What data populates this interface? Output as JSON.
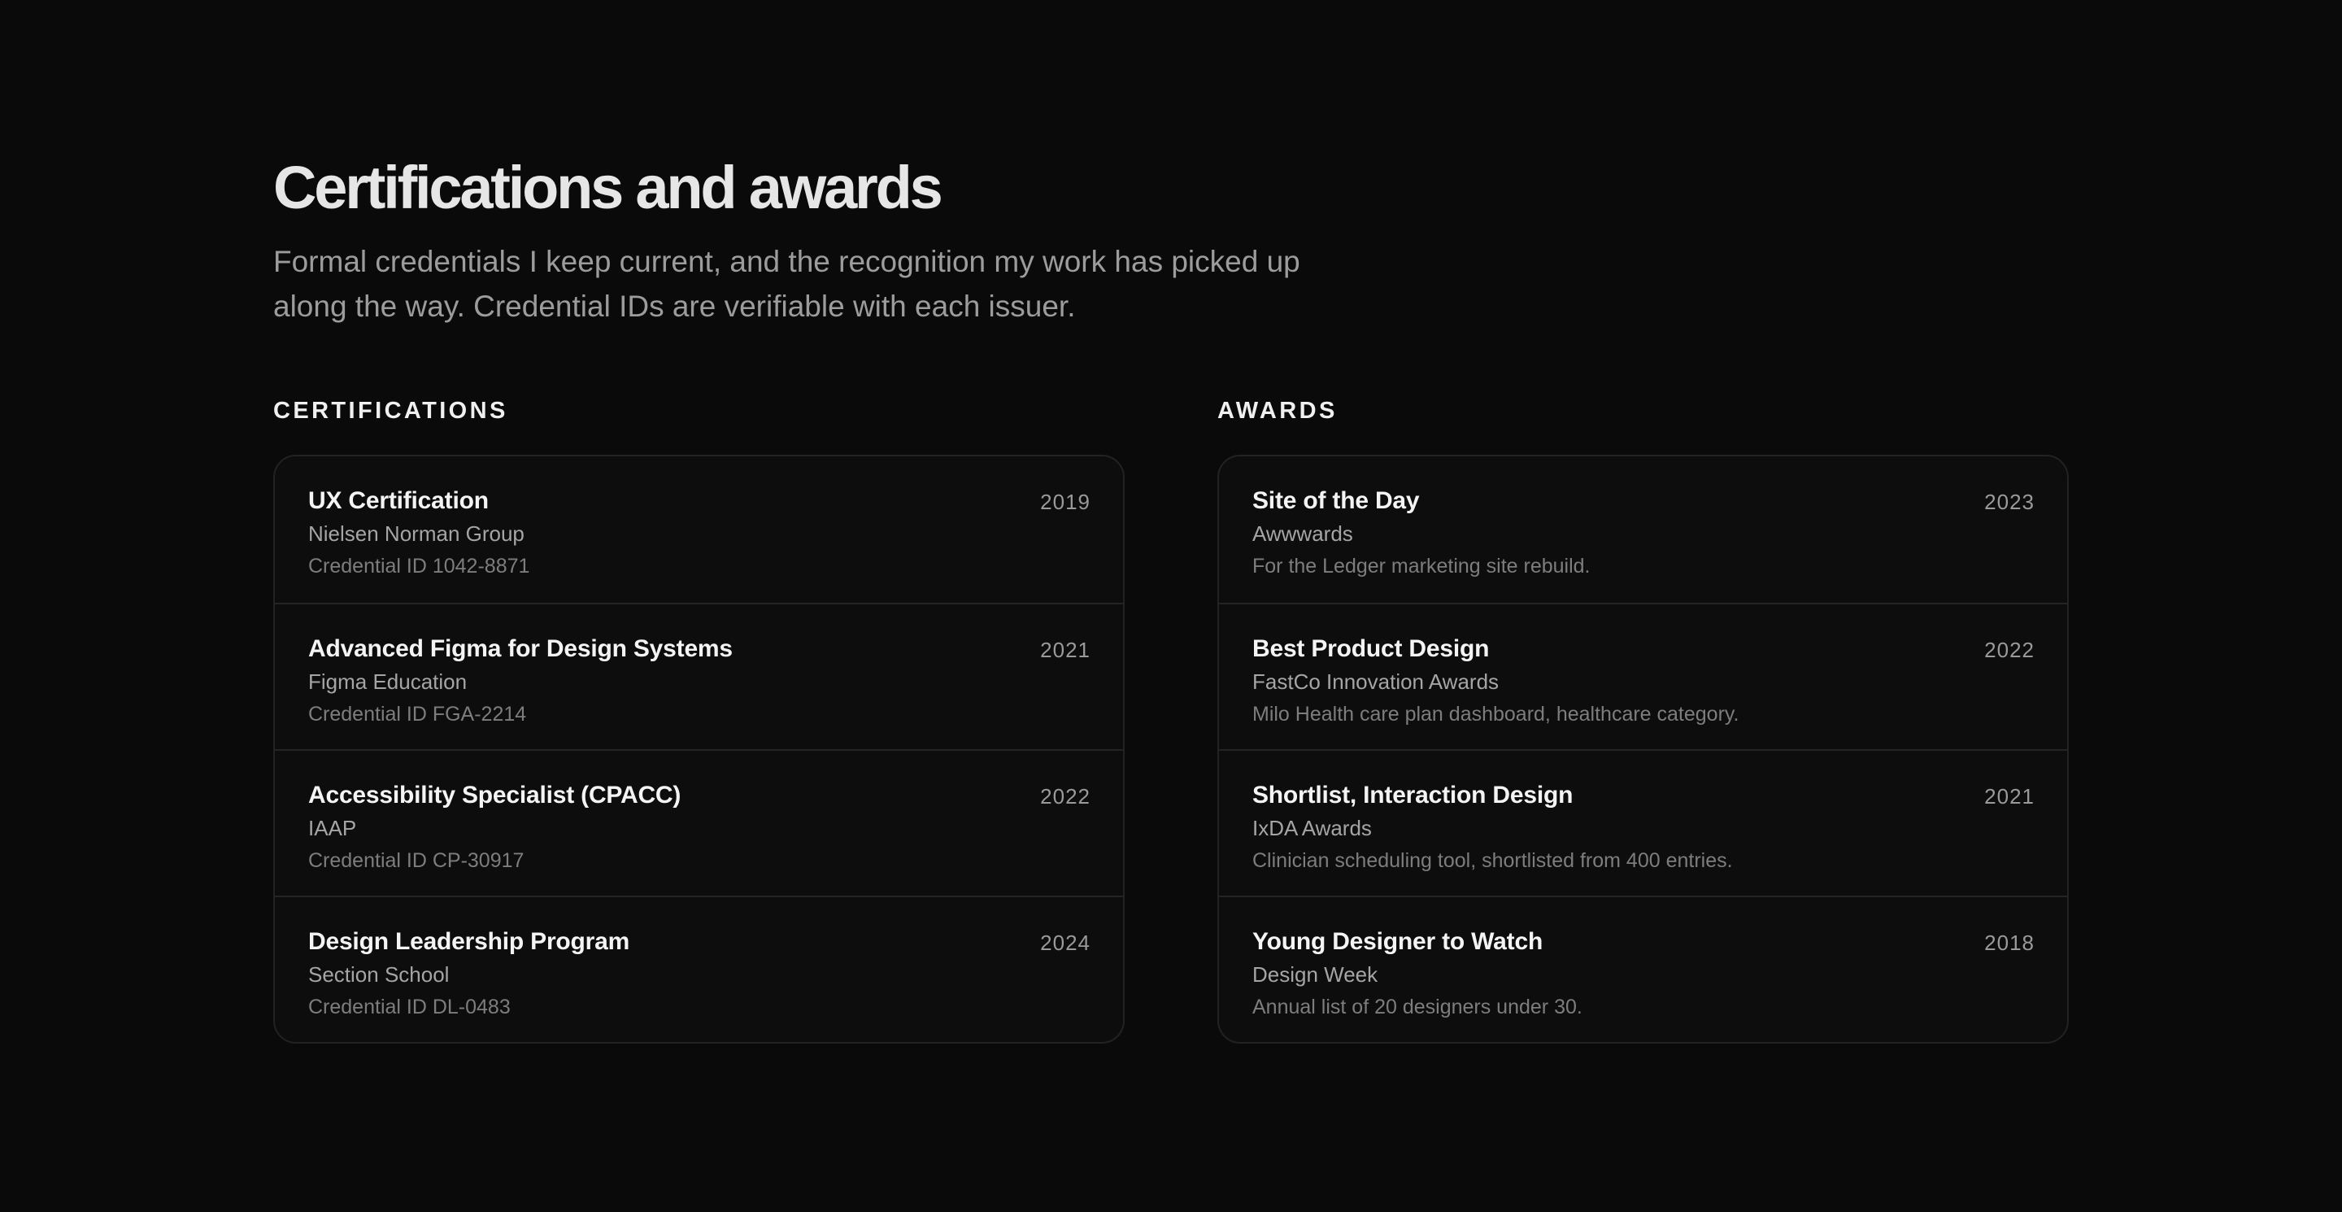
{
  "header": {
    "title": "Certifications and awards",
    "subtitle_line1": "Formal credentials I keep current, and the recognition my work has picked up",
    "subtitle_line2": "along the way. Credential IDs are verifiable with each issuer."
  },
  "certifications": {
    "heading": "CERTIFICATIONS",
    "items": [
      {
        "title": "UX Certification",
        "issuer": "Nielsen Norman Group",
        "detail": "Credential ID 1042-8871",
        "year": "2019"
      },
      {
        "title": "Advanced Figma for Design Systems",
        "issuer": "Figma Education",
        "detail": "Credential ID FGA-2214",
        "year": "2021"
      },
      {
        "title": "Accessibility Specialist (CPACC)",
        "issuer": "IAAP",
        "detail": "Credential ID CP-30917",
        "year": "2022"
      },
      {
        "title": "Design Leadership Program",
        "issuer": "Section School",
        "detail": "Credential ID DL-0483",
        "year": "2024"
      }
    ]
  },
  "awards": {
    "heading": "AWARDS",
    "items": [
      {
        "title": "Site of the Day",
        "issuer": "Awwwards",
        "detail": "For the Ledger marketing site rebuild.",
        "year": "2023"
      },
      {
        "title": "Best Product Design",
        "issuer": "FastCo Innovation Awards",
        "detail": "Milo Health care plan dashboard, healthcare category.",
        "year": "2022"
      },
      {
        "title": "Shortlist, Interaction Design",
        "issuer": "IxDA Awards",
        "detail": "Clinician scheduling tool, shortlisted from 400 entries.",
        "year": "2021"
      },
      {
        "title": "Young Designer to Watch",
        "issuer": "Design Week",
        "detail": "Annual list of 20 designers under 30.",
        "year": "2018"
      }
    ]
  }
}
